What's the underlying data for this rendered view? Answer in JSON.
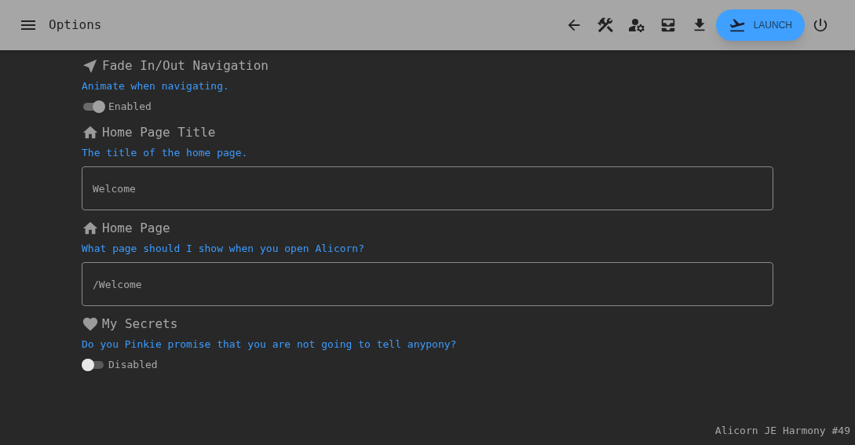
{
  "header": {
    "title": "Options",
    "launch_label": "LAUNCH"
  },
  "sections": [
    {
      "kind": "toggle",
      "title": "Fade In/Out Navigation",
      "description": "Animate when navigating.",
      "on": true,
      "state_label": "Enabled"
    },
    {
      "kind": "text",
      "title": "Home Page Title",
      "description": "The title of the home page.",
      "value": "Welcome"
    },
    {
      "kind": "text",
      "title": "Home Page",
      "description": "What page should I show when you open Alicorn?",
      "value": "/Welcome"
    },
    {
      "kind": "toggle",
      "title": "My Secrets",
      "description": "Do you Pinkie promise that you are not going to tell anypony?",
      "on": false,
      "state_label": "Disabled"
    }
  ],
  "version": "Alicorn JE Harmony #49"
}
